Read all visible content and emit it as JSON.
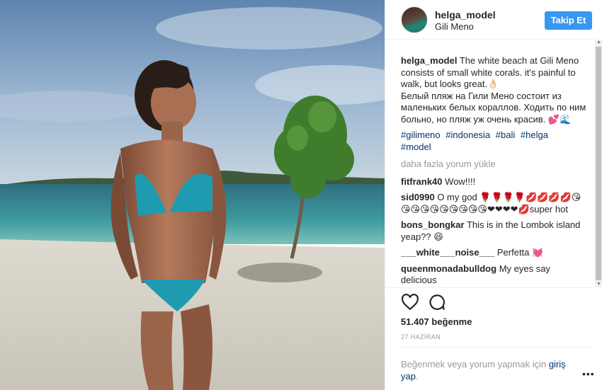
{
  "post": {
    "username": "helga_model",
    "location": "Gili Meno",
    "follow_label": "Takip Et"
  },
  "caption": {
    "user": "helga_model",
    "text_en": "The white beach at Gili Meno consists of small white corals. it's painful to walk, but looks great.👌🏻",
    "text_ru": "Белый пляж на Гили Мено состоит из маленьких белых кораллов. Ходить по ним больно, но пляж уж очень красив. 💕🌊",
    "hashtags": [
      "#gilimeno",
      "#indonesia",
      "#bali",
      "#helga",
      "#model"
    ]
  },
  "load_more_label": "daha fazla yorum yükle",
  "comments": [
    {
      "user": "fitfrank40",
      "text": "Wow!!!!"
    },
    {
      "user": "sid0990",
      "text": "O my god 🌹🌹🌹🌹💋💋💋💋😘😘😘😘😘😘😘😘😘😘❤❤❤❤💋super hot"
    },
    {
      "user": "bons_bongkar",
      "text": "This is in the Lombok island yeap?? 😆"
    },
    {
      "user": "___white___noise___",
      "text": "Perfetta 💓"
    },
    {
      "user": "queenmonadabulldog",
      "text": "My eyes say delicious"
    }
  ],
  "likes_label": "51.407 beğenme",
  "date_label": "27 HAZİRAN",
  "login": {
    "prefix": "Beğenmek veya yorum yapmak için ",
    "link": "giriş yap",
    "suffix": "."
  },
  "icons": {
    "like": "heart-outline-icon",
    "comment": "speech-bubble-icon",
    "more": "ellipsis-icon"
  },
  "colors": {
    "accent": "#3897f0",
    "link": "#003569",
    "muted": "#999999",
    "text": "#262626"
  }
}
